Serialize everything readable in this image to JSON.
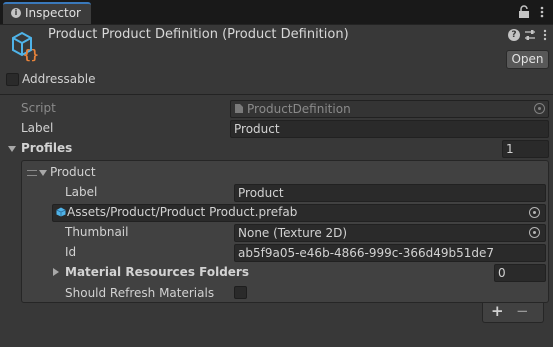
{
  "tab": {
    "title": "Inspector"
  },
  "header": {
    "title": "Product Product Definition (Product Definition)",
    "open_label": "Open",
    "addressable_label": "Addressable",
    "addressable_checked": false
  },
  "fields": {
    "script_label": "Script",
    "script_value": "ProductDefinition",
    "label_label": "Label",
    "label_value": "Product",
    "profiles_label": "Profiles",
    "profiles_count": "1"
  },
  "profile": {
    "name": "Product",
    "label_label": "Label",
    "label_value": "Product",
    "prefab_path": "Assets/Product/Product Product.prefab",
    "thumbnail_label": "Thumbnail",
    "thumbnail_value": "None (Texture 2D)",
    "id_label": "Id",
    "id_value": "ab5f9a05-e46b-4866-999c-366d49b51de7",
    "materials_label": "Material Resources Folders",
    "materials_count": "0",
    "refresh_label": "Should Refresh Materials",
    "refresh_checked": false
  },
  "list_footer": {
    "add": "+",
    "remove": "−"
  },
  "colors": {
    "accent": "#3a79bb",
    "icon_blue": "#4fb3e8",
    "icon_orange": "#e8833a"
  }
}
